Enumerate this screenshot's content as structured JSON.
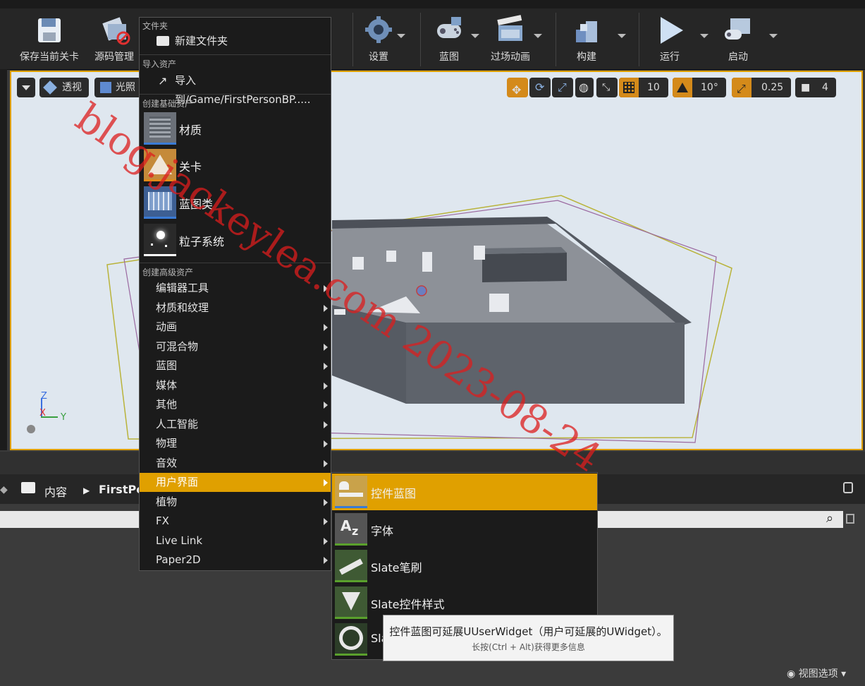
{
  "toolbar": {
    "buttons": [
      {
        "label": "保存当前关卡",
        "icon": "save-icon"
      },
      {
        "label": "源码管理",
        "icon": "source-control-icon"
      },
      {
        "label": "设置",
        "icon": "settings-gear-icon"
      },
      {
        "label": "蓝图",
        "icon": "blueprint-gamepad-icon"
      },
      {
        "label": "过场动画",
        "icon": "cinematics-clapper-icon"
      },
      {
        "label": "构建",
        "icon": "build-blocks-icon"
      },
      {
        "label": "运行",
        "icon": "play-icon"
      },
      {
        "label": "启动",
        "icon": "launch-icon"
      }
    ]
  },
  "viewport": {
    "perspective_label": "透视",
    "lit_label": "光照",
    "grid_snap_value": "10",
    "rotation_snap_value": "10°",
    "scale_snap_value": "0.25",
    "camera_speed_value": "4",
    "axis": {
      "z": "Z",
      "x": "X",
      "y": "Y"
    }
  },
  "menu": {
    "sections": {
      "folder": "文件夹",
      "import": "导入资产",
      "basic": "创建基础资产",
      "advanced": "创建高级资产"
    },
    "new_folder": "新建文件夹",
    "import_to": "导入到/Game/FirstPersonBP.....",
    "basic_assets": [
      {
        "label": "材质",
        "icon": "material-icon",
        "color": "#3a7bd5"
      },
      {
        "label": "关卡",
        "icon": "level-icon",
        "color": "#e08a1a"
      },
      {
        "label": "蓝图类",
        "icon": "blueprint-class-icon",
        "color": "#3a7bd5"
      },
      {
        "label": "粒子系统",
        "icon": "particle-system-icon",
        "color": "#ffffff"
      }
    ],
    "advanced_assets": [
      "编辑器工具",
      "材质和纹理",
      "动画",
      "可混合物",
      "蓝图",
      "媒体",
      "其他",
      "人工智能",
      "物理",
      "音效",
      "用户界面",
      "植物",
      "FX",
      "Live Link",
      "Paper2D"
    ],
    "active_index": 10
  },
  "submenu": {
    "items": [
      {
        "label": "控件蓝图",
        "icon": "widget-blueprint-icon"
      },
      {
        "label": "字体",
        "icon": "font-icon"
      },
      {
        "label": "Slate笔刷",
        "icon": "slate-brush-icon"
      },
      {
        "label": "Slate控件样式",
        "icon": "slate-widget-style-icon"
      },
      {
        "label": "Sla",
        "icon": "slate-ring-icon"
      }
    ]
  },
  "tooltip": {
    "main": "控件蓝图可延展UUserWidget（用户可延展的UWidget）。",
    "sub": "长按(Ctrl + Alt)获得更多信息"
  },
  "content_browser": {
    "breadcrumb_root": "内容",
    "breadcrumb_current": "FirstPe",
    "view_options": "视图选项"
  },
  "watermark": "blog.jackeylea.com 2023-08-24",
  "colors": {
    "accent": "#e0a000",
    "menu_bg": "#1b1b1b"
  }
}
